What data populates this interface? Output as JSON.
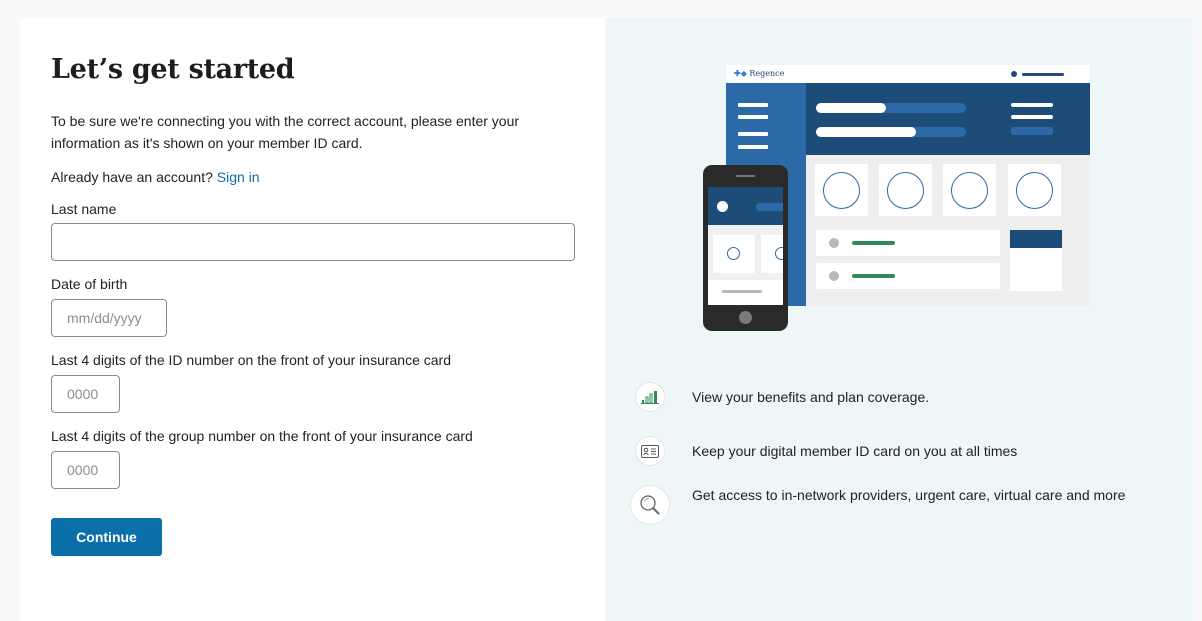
{
  "form": {
    "title": "Let’s get started",
    "intro": "To be sure we're connecting you with the correct account, please enter your information as it's shown on your member ID card.",
    "already_prefix": "Already have an account?",
    "signin_link": "Sign in",
    "last_name_label": "Last name",
    "last_name_value": "",
    "dob_label": "Date of birth",
    "dob_placeholder": "mm/dd/yyyy",
    "id_label": "Last 4 digits of the ID number on the front of your insurance card",
    "id_placeholder": "0000",
    "group_label": "Last 4 digits of the group number on the front of your insurance card",
    "group_placeholder": "0000",
    "continue_label": "Continue"
  },
  "illustration": {
    "brand": "Regence"
  },
  "features": [
    {
      "icon": "bar-chart-icon",
      "text": "View your benefits and plan coverage."
    },
    {
      "icon": "id-card-icon",
      "text": "Keep your digital member ID card on you at all times"
    },
    {
      "icon": "magnifier-icon",
      "text": "Get access to in-network providers, urgent care, virtual care and more"
    }
  ],
  "colors": {
    "primary": "#0b6fa8",
    "navy": "#1e4c79",
    "accent_green": "#2f8a5a",
    "panel_bg": "#eef6f8"
  }
}
